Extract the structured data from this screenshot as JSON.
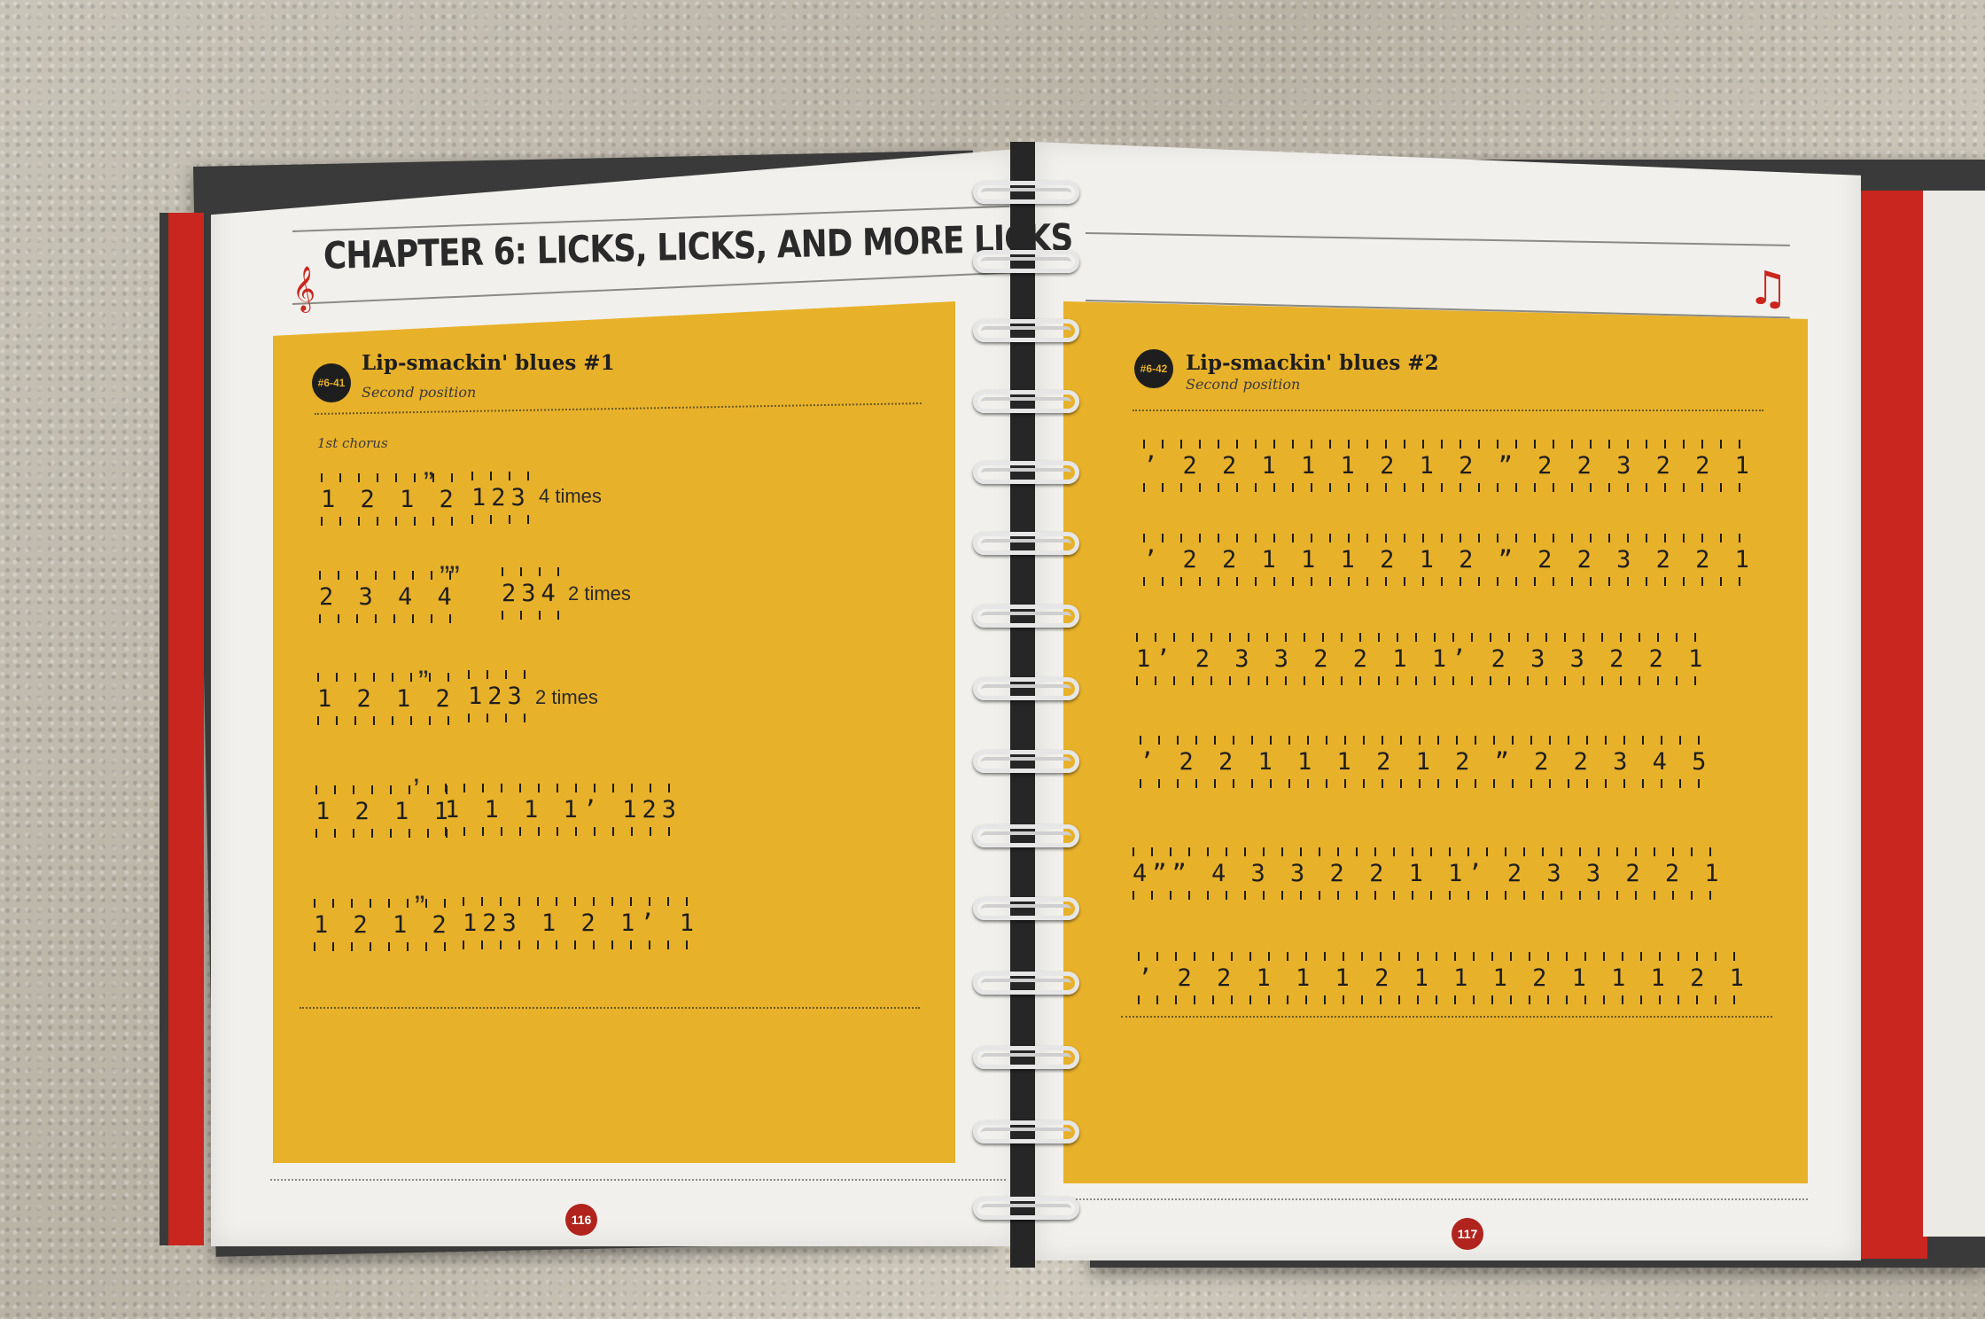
{
  "left_page": {
    "chapter_title_prefix": "CHAPTER 6: ",
    "chapter_title_rest": "LICKS, LICKS, AND MORE LICKS",
    "clef_symbol": "𝄞",
    "badge": "#6-41",
    "section_title": "Lip-smackin' blues #1",
    "section_subtitle": "Second position",
    "chorus_label": "1st chorus",
    "lines": [
      {
        "tab": "1 2 1 2",
        "breath": "”",
        "tab2": "123",
        "times": "4 times"
      },
      {
        "tab": "2 3 4 4",
        "breath": "””",
        "tab2": "234",
        "times": "2 times"
      },
      {
        "tab": "1 2 1 2",
        "breath": "”",
        "tab2": "123",
        "times": "2 times"
      },
      {
        "tab": "1 2 1 1",
        "breath": "’",
        "tab2": "1 1 1 1’ 123",
        "times": ""
      },
      {
        "tab": "1 2 1 2",
        "breath": "”",
        "tab2": "123   1 2 1’ 1",
        "times": ""
      }
    ],
    "page_number": "116"
  },
  "right_page": {
    "note_icon": "♫",
    "badge": "#6-42",
    "section_title": "Lip-smackin' blues #2",
    "section_subtitle": "Second position",
    "lines": [
      "’ 2 2 1 1 1 2 1 2 ” 2 2 3 2 2 1",
      "’ 2 2 1 1 1 2 1 2 ” 2 2 3 2 2 1",
      "1’ 2 3 3 2 2 1   1’ 2 3 3 2 2 1",
      "’ 2 2 1 1 1 2 1 2 ” 2 2 3 4 5",
      "4”” 4 3 3 2 2 1   1’ 2 3 3 2 2 1",
      "’ 2 2 1   1 1 2 1   1 1 2 1   1 1 2 1"
    ],
    "page_number": "117"
  },
  "colors": {
    "yellow": "#e8b12a",
    "red": "#c8261f",
    "page": "#f1f0ec"
  }
}
